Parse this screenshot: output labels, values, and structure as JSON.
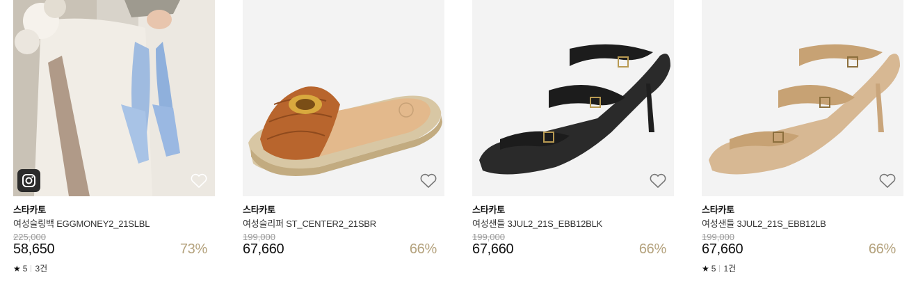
{
  "products": [
    {
      "brand": "스타카토",
      "name": "여성슬링백 EGGMONEY2_21SLBL",
      "original_price": "225,000",
      "price": "58,650",
      "discount": "73%",
      "rating": "5",
      "review_count": "3건",
      "has_instagram": true,
      "image_icon": "blue-slingback-heels-photo"
    },
    {
      "brand": "스타카토",
      "name": "여성슬리퍼 ST_CENTER2_21SBR",
      "original_price": "199,000",
      "price": "67,660",
      "discount": "66%",
      "image_icon": "brown-espadrille-slide-photo"
    },
    {
      "brand": "스타카토",
      "name": "여성샌들 3JUL2_21S_EBB12BLK",
      "original_price": "199,000",
      "price": "67,660",
      "discount": "66%",
      "image_icon": "black-strappy-heel-sandal-photo"
    },
    {
      "brand": "스타카토",
      "name": "여성샌들 3JUL2_21S_EBB12LB",
      "original_price": "199,000",
      "price": "67,660",
      "discount": "66%",
      "rating": "5",
      "review_count": "1건",
      "image_icon": "beige-strappy-heel-sandal-photo"
    }
  ],
  "colors": {
    "discount": "#b4a27d",
    "original_price": "#9a9a9a",
    "thumb_bg": "#f3f3f3"
  },
  "icons": {
    "wishlist": "heart-outline-icon",
    "instagram": "instagram-icon",
    "rating": "star-icon"
  }
}
